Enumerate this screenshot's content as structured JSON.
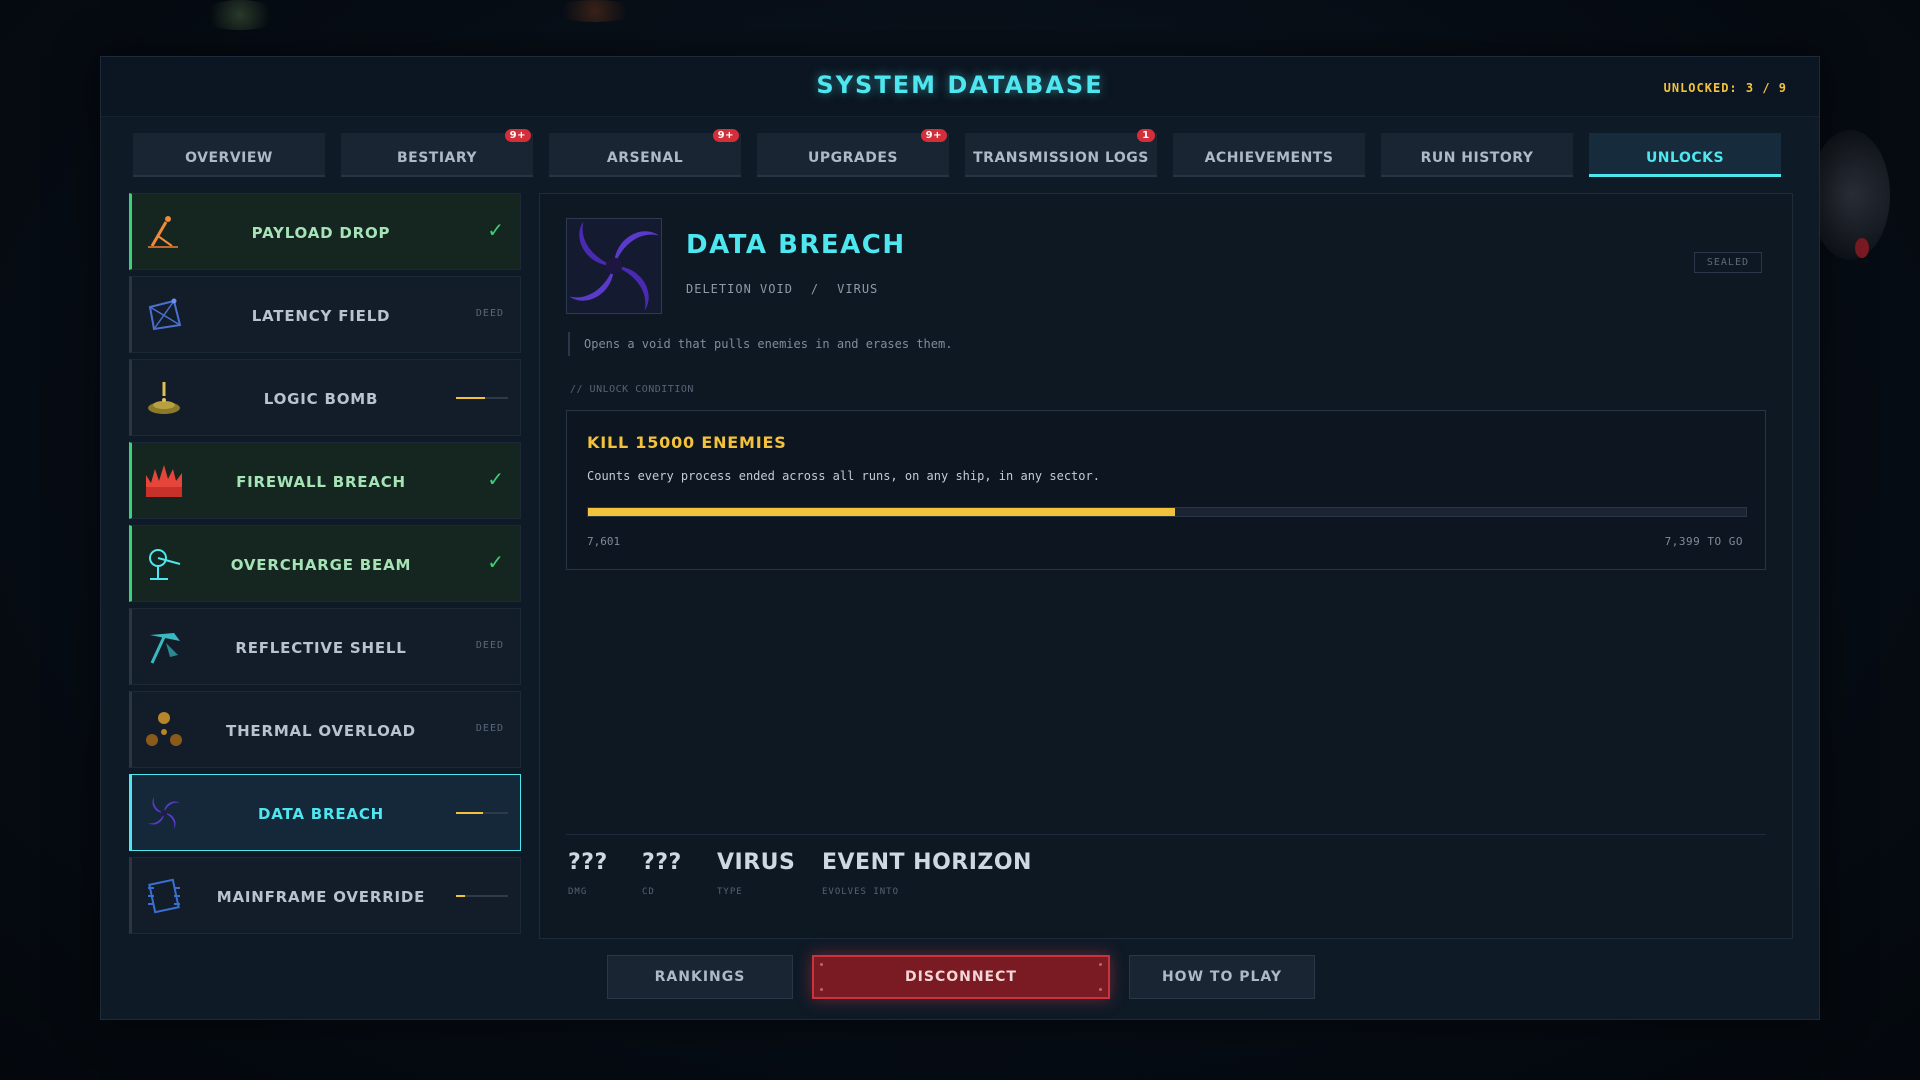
{
  "header": {
    "title": "SYSTEM DATABASE",
    "unlocked": "UNLOCKED: 3 / 9"
  },
  "tabs": [
    {
      "label": "OVERVIEW",
      "badge": ""
    },
    {
      "label": "BESTIARY",
      "badge": "9+"
    },
    {
      "label": "ARSENAL",
      "badge": "9+"
    },
    {
      "label": "UPGRADES",
      "badge": "9+"
    },
    {
      "label": "TRANSMISSION LOGS",
      "badge": "1"
    },
    {
      "label": "ACHIEVEMENTS",
      "badge": ""
    },
    {
      "label": "RUN HISTORY",
      "badge": ""
    },
    {
      "label": "UNLOCKS",
      "badge": ""
    }
  ],
  "unlocks": [
    {
      "name": "PAYLOAD DROP",
      "state": "unlocked",
      "status": "✓",
      "progress": 1.0,
      "icon": "mortar-icon"
    },
    {
      "name": "LATENCY FIELD",
      "state": "deed",
      "status": "DEED",
      "progress": 0,
      "icon": "net-icon"
    },
    {
      "name": "LOGIC BOMB",
      "state": "progress",
      "status": "",
      "progress": 0.55,
      "icon": "landmine-icon"
    },
    {
      "name": "FIREWALL BREACH",
      "state": "unlocked",
      "status": "✓",
      "progress": 1.0,
      "icon": "flame-icon"
    },
    {
      "name": "OVERCHARGE BEAM",
      "state": "unlocked",
      "status": "✓",
      "progress": 1.0,
      "icon": "laser-turret-icon"
    },
    {
      "name": "REFLECTIVE SHELL",
      "state": "deed",
      "status": "DEED",
      "progress": 0,
      "icon": "pickaxe-icon"
    },
    {
      "name": "THERMAL OVERLOAD",
      "state": "deed",
      "status": "DEED",
      "progress": 0,
      "icon": "radiation-icon"
    },
    {
      "name": "DATA BREACH",
      "state": "selected",
      "status": "",
      "progress": 0.51,
      "icon": "vortex-icon"
    },
    {
      "name": "MAINFRAME OVERRIDE",
      "state": "progress",
      "status": "",
      "progress": 0.18,
      "icon": "chip-icon"
    }
  ],
  "detail": {
    "name": "DATA BREACH",
    "category": "DELETION VOID",
    "separator": "/",
    "type": "VIRUS",
    "state": "SEALED",
    "description": "Opens a void that pulls enemies in and erases them.",
    "condition_label": "// UNLOCK CONDITION",
    "condition_title": "KILL 15000 ENEMIES",
    "condition_text": "Counts every process ended across all runs, on any ship, in any sector.",
    "progress_current": "7,601",
    "progress_remaining": "7,399 TO GO",
    "progress_fraction": 0.5067,
    "stats": [
      {
        "value": "???",
        "label": "DMG"
      },
      {
        "value": "???",
        "label": "CD"
      },
      {
        "value": "VIRUS",
        "label": "TYPE"
      },
      {
        "value": "EVENT HORIZON",
        "label": "EVOLVES INTO"
      }
    ]
  },
  "buttons": {
    "rankings": "RANKINGS",
    "disconnect": "DISCONNECT",
    "how_to_play": "HOW TO PLAY"
  },
  "colors": {
    "accent": "#4ee6ef",
    "gold": "#f2c23c",
    "success": "#3bd17a",
    "danger": "#c8343e"
  }
}
